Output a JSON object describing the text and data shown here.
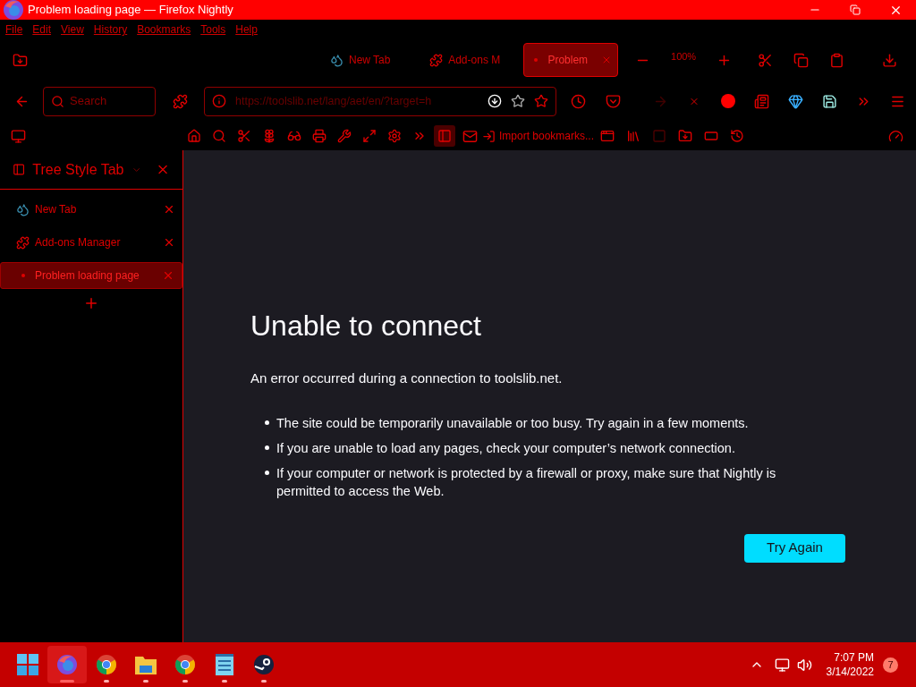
{
  "window": {
    "title": "Problem loading page — Firefox Nightly"
  },
  "menu": [
    "File",
    "Edit",
    "View",
    "History",
    "Bookmarks",
    "Tools",
    "Help"
  ],
  "tabs": [
    {
      "label": "New Tab",
      "selected": false,
      "kind": "newtab"
    },
    {
      "label": "Add-ons M",
      "selected": false,
      "kind": "addons"
    },
    {
      "label": "Problem",
      "selected": true,
      "kind": "error"
    }
  ],
  "zoom": "100%",
  "search": {
    "placeholder": "Search"
  },
  "url": "https://toolslib.net/lang/aet/en/?target=h",
  "bookmarks": {
    "import": "Import bookmarks..."
  },
  "sidebar": {
    "title": "Tree Style Tab",
    "tabs": [
      {
        "label": "New Tab",
        "selected": false,
        "kind": "newtab"
      },
      {
        "label": "Add-ons Manager",
        "selected": false,
        "kind": "addons"
      },
      {
        "label": "Problem loading page",
        "selected": true,
        "kind": "error"
      }
    ]
  },
  "error": {
    "heading": "Unable to connect",
    "intro": "An error occurred during a connection to toolslib.net.",
    "bullets": [
      "The site could be temporarily unavailable or too busy. Try again in a few moments.",
      "If you are unable to load any pages, check your computer’s network connection.",
      "If your computer or network is protected by a firewall or proxy, make sure that Nightly is permitted to access the Web."
    ],
    "button": "Try Again"
  },
  "taskbar": {
    "apps": [
      {
        "kind": "start",
        "selected": false
      },
      {
        "kind": "firefox",
        "selected": true
      },
      {
        "kind": "chrome",
        "selected": false
      },
      {
        "kind": "folder",
        "selected": false
      },
      {
        "kind": "chrome",
        "selected": false
      },
      {
        "kind": "notepad",
        "selected": false
      },
      {
        "kind": "steam",
        "selected": false
      }
    ],
    "time": "7:07 PM",
    "date": "3/14/2022",
    "notifications": "7"
  }
}
